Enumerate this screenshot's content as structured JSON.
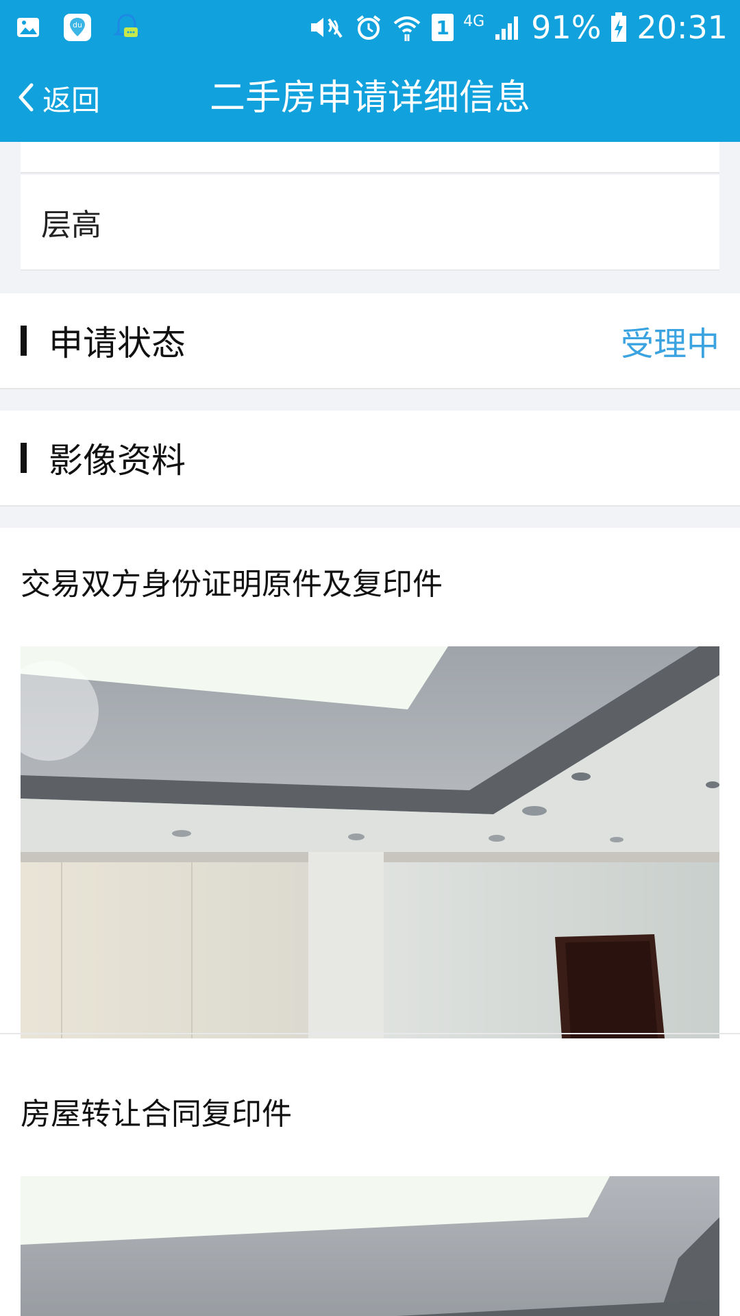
{
  "status_bar": {
    "battery": "91%",
    "time": "20:31",
    "sim_slot": "1",
    "network": "4G",
    "icons": [
      "gallery-icon",
      "baidu-map-icon",
      "chat-bell-icon",
      "mute-icon",
      "alarm-icon",
      "wifi-icon",
      "sim-icon",
      "signal-icon",
      "battery-charging-icon"
    ]
  },
  "nav": {
    "back_label": "返回",
    "title": "二手房申请详细信息"
  },
  "details": {
    "floor_label": "层高"
  },
  "status_section": {
    "title": "申请状态",
    "value": "受理中"
  },
  "images_section": {
    "title": "影像资料",
    "items": [
      {
        "label": "交易双方身份证明原件及复印件"
      },
      {
        "label": "房屋转让合同复印件"
      }
    ]
  },
  "colors": {
    "header_blue": "#11a2dd",
    "status_blue": "#3aa3e0",
    "background": "#f2f3f6"
  }
}
